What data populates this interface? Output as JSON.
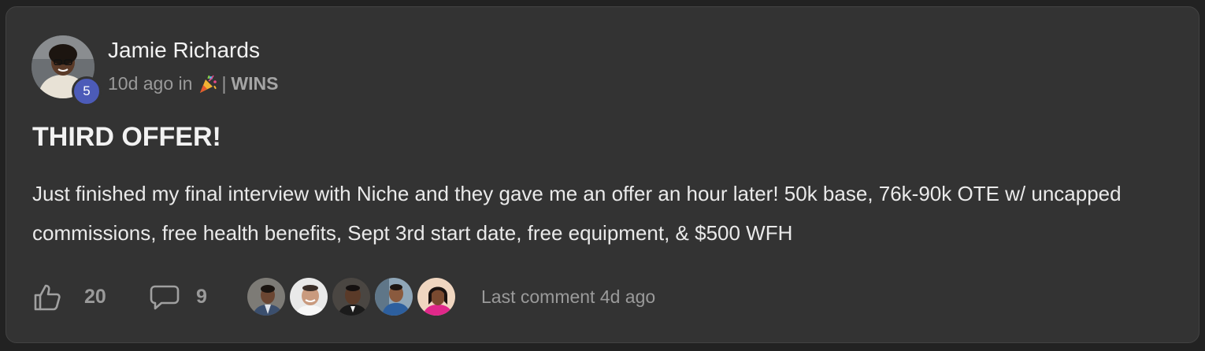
{
  "post": {
    "author": {
      "name": "Jamie Richards",
      "level": "5"
    },
    "meta": {
      "time_ago": "10d ago in",
      "category_icon": "party-popper-icon",
      "separator": "|",
      "category": "WINS"
    },
    "title": "THIRD OFFER!",
    "body": "Just finished my final interview with Niche and they gave me an offer an hour later! 50k base, 76k-90k OTE w/ uncapped commissions, free health benefits, Sept 3rd start date, free equipment, & $500 WFH"
  },
  "footer": {
    "likes": "20",
    "comments": "9",
    "last_comment": "Last comment 4d ago",
    "commenters": [
      {
        "name": "commenter-avatar-1"
      },
      {
        "name": "commenter-avatar-2"
      },
      {
        "name": "commenter-avatar-3"
      },
      {
        "name": "commenter-avatar-4"
      },
      {
        "name": "commenter-avatar-5"
      }
    ]
  },
  "colors": {
    "background": "#222222",
    "card": "#333333",
    "level_badge": "#4c5bb8",
    "muted_text": "#9a9a9a",
    "primary_text": "#f2f2f2"
  }
}
